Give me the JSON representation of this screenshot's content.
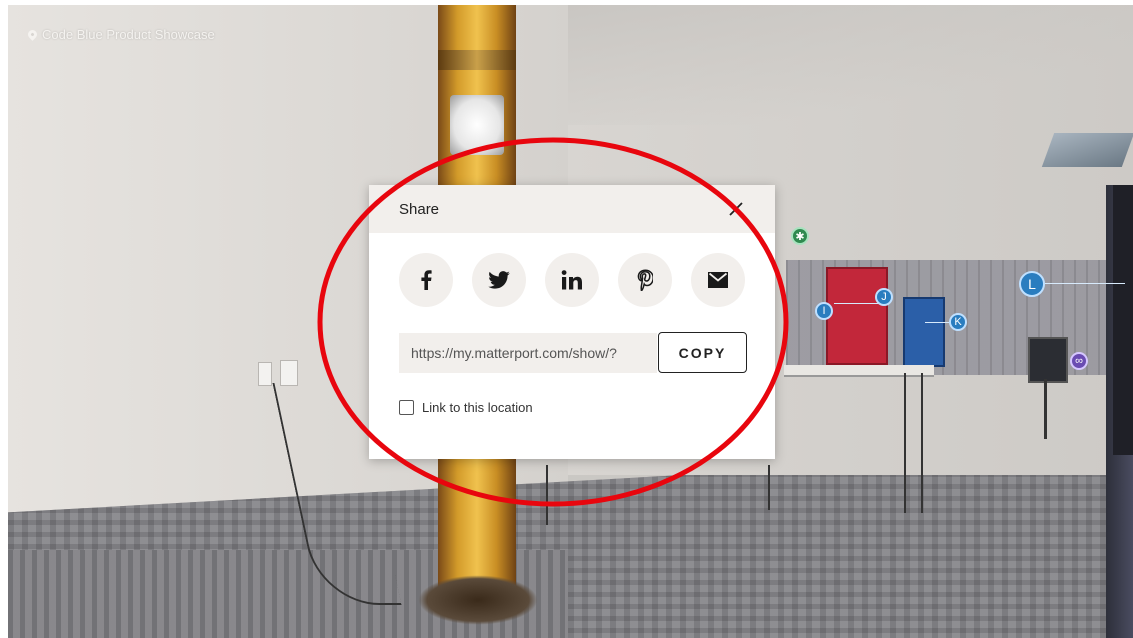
{
  "tour": {
    "title": "Code Blue Product Showcase",
    "hotspots": [
      "I",
      "J",
      "K",
      "L"
    ]
  },
  "share_dialog": {
    "title": "Share",
    "social": [
      {
        "name": "facebook",
        "glyph": "f"
      },
      {
        "name": "twitter",
        "glyph": "twitter-bird"
      },
      {
        "name": "linkedin",
        "glyph": "in"
      },
      {
        "name": "pinterest",
        "glyph": "p"
      },
      {
        "name": "email",
        "glyph": "envelope"
      }
    ],
    "link_value": "https://my.matterport.com/show/?",
    "copy_label": "COPY",
    "link_location_label": "Link to this location",
    "link_location_checked": false
  },
  "colors": {
    "annotation": "#e8060e",
    "dialog_header": "#f2efec",
    "button_bg": "#f2efec"
  }
}
